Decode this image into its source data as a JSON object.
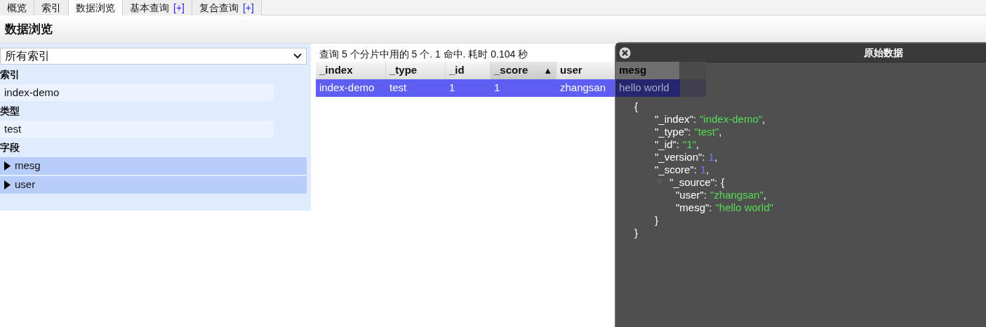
{
  "tabs": [
    {
      "label": "概览",
      "selected": false
    },
    {
      "label": "索引",
      "selected": false
    },
    {
      "label": "数据浏览",
      "selected": true
    },
    {
      "label": "基本查询",
      "extra": "[+]",
      "selected": false
    },
    {
      "label": "复合查询",
      "extra": "[+]",
      "selected": false
    }
  ],
  "page_title": "数据浏览",
  "sidebar": {
    "select": {
      "value": "所有索引"
    },
    "sections": [
      {
        "title": "索引",
        "items": [
          {
            "label": "index-demo",
            "kind": "plain"
          }
        ]
      },
      {
        "title": "类型",
        "items": [
          {
            "label": "test",
            "kind": "plain"
          }
        ]
      },
      {
        "title": "字段",
        "items": [
          {
            "label": "mesg",
            "kind": "field",
            "expanded": false
          },
          {
            "label": "user",
            "kind": "field",
            "expanded": false
          }
        ]
      }
    ]
  },
  "summary": "查询 5 个分片中用的 5 个. 1 命中. 耗时 0.104 秒",
  "table": {
    "columns": [
      {
        "label": "_index",
        "sorted": false
      },
      {
        "label": "_type",
        "sorted": false
      },
      {
        "label": "_id",
        "sorted": false
      },
      {
        "label": "_score",
        "sort_mark": "▲",
        "sorted": true
      },
      {
        "label": "user",
        "sorted": false
      },
      {
        "label": "mesg",
        "sorted": false
      }
    ],
    "rows": [
      {
        "cells": [
          "index-demo",
          "test",
          "1",
          "1",
          "zhangsan",
          "hello world"
        ],
        "selected": true
      }
    ]
  },
  "dialog": {
    "title": "原始数据",
    "open": "{",
    "close": "}",
    "entries": [
      {
        "key": "\"_index\"",
        "colon": ":",
        "value": "\"index-demo\"",
        "kind": "string",
        "comma": ","
      },
      {
        "key": "\"_type\"",
        "colon": ":",
        "value": "\"test\"",
        "kind": "string",
        "comma": ","
      },
      {
        "key": "\"_id\"",
        "colon": ":",
        "value": "\"1\"",
        "kind": "string",
        "comma": ","
      },
      {
        "key": "\"_version\"",
        "colon": ":",
        "value": "1",
        "kind": "number",
        "comma": ","
      },
      {
        "key": "\"_score\"",
        "colon": ":",
        "value": "1",
        "kind": "number",
        "comma": ","
      },
      {
        "key": "\"_source\"",
        "colon": ":",
        "kind": "object",
        "open": "{",
        "close": "}",
        "expanded": true,
        "children": [
          {
            "key": "\"user\"",
            "colon": ":",
            "value": "\"zhangsan\"",
            "kind": "string",
            "comma": ","
          },
          {
            "key": "\"mesg\"",
            "colon": ":",
            "value": "\"hello world\"",
            "kind": "string"
          }
        ]
      }
    ]
  }
}
